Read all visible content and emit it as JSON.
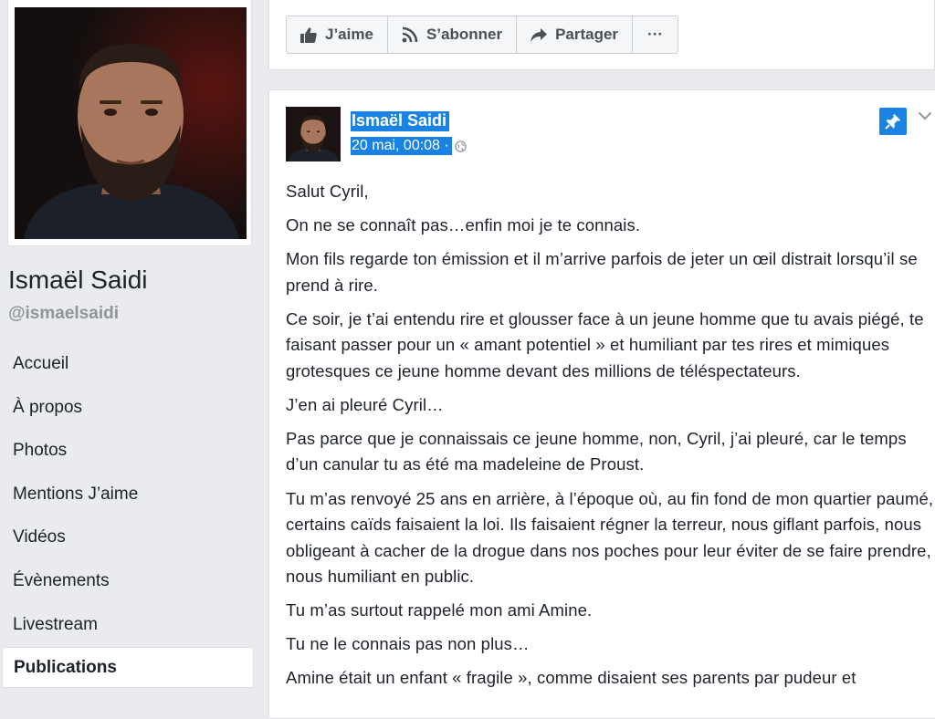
{
  "profile": {
    "name": "Ismaël Saidi",
    "handle": "@ismaelsaidi"
  },
  "nav": {
    "items": [
      {
        "label": "Accueil"
      },
      {
        "label": "À propos"
      },
      {
        "label": "Photos"
      },
      {
        "label": "Mentions J’aime"
      },
      {
        "label": "Vidéos"
      },
      {
        "label": "Évènements"
      },
      {
        "label": "Livestream"
      },
      {
        "label": "Publications"
      }
    ],
    "active_index": 7
  },
  "actions": {
    "like_label": "J’aime",
    "subscribe_label": "S’abonner",
    "share_label": "Partager",
    "more_label": "···"
  },
  "post": {
    "author": "Ismaël Saidi",
    "date": "20 mai, 00:08 ·",
    "paragraphs": [
      "Salut Cyril,",
      "On ne se connaît pas…enfin moi je te connais.",
      "Mon fils regarde ton émission et il m’arrive parfois de jeter un œil distrait lorsqu’il se prend à rire.",
      "Ce soir, je t’ai entendu rire et glousser face à un jeune homme que tu avais piégé, te faisant passer pour un « amant potentiel » et humiliant par tes rires et mimiques grotesques ce jeune homme devant des millions de téléspectateurs.",
      "J’en ai pleuré Cyril…",
      "Pas parce que je connaissais ce jeune homme, non, Cyril, j’ai pleuré, car le temps d’un canular tu as été ma madeleine de Proust.",
      "Tu m’as renvoyé 25 ans en arrière, à l’époque où, au fin fond de mon quartier paumé, certains caïds faisaient la loi. Ils faisaient régner la terreur, nous giflant parfois, nous obligeant à cacher de la drogue dans nos poches pour leur éviter de se faire prendre, nous humiliant en public.",
      "Tu m’as surtout rappelé mon ami Amine.",
      "Tu ne le connais pas non plus…",
      "Amine était un enfant « fragile », comme disaient ses parents par pudeur et"
    ]
  },
  "colors": {
    "page_bg": "#e9ebee",
    "selection": "#1a82e2",
    "muted_text": "#90949c",
    "button_text": "#4b4f56"
  }
}
